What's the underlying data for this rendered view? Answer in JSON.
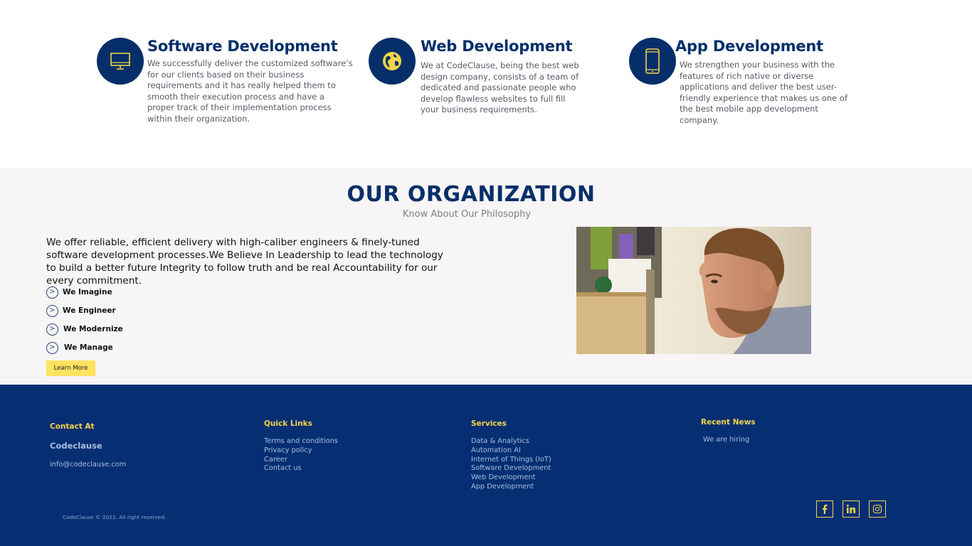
{
  "services": [
    {
      "title": "Software Development",
      "icon": "monitor-icon",
      "text": "We successfully deliver the customized software’s for our clients based on their business requirements and it has really helped them to smooth their execution process and have a proper track of their implementation process within their organization."
    },
    {
      "title": "Web Development",
      "icon": "globe-icon",
      "text": "We at CodeClause, being the best web design company, consists of a team of dedicated and passionate people who develop flawless websites to full fill your business requirements."
    },
    {
      "title": "App Development",
      "icon": "smartphone-icon",
      "text": "We strengthen your business with the features of rich native or diverse applications and deliver the best user-friendly experience that makes us one of the best mobile app development company."
    }
  ],
  "organization": {
    "title": "OUR ORGANIZATION",
    "subtitle": "Know About Our Philosophy",
    "paragraph": "We offer reliable, efficient delivery with high-caliber engineers & finely-tuned software development processes.We Believe In Leadership to lead the technology to build a better future Integrity to follow truth and be real Accountability for our every commitment.",
    "items": [
      "We Imagine",
      "We Engineer",
      "We Modernize",
      "We Manage"
    ],
    "bullet_glyph": ">",
    "button_label": "Learn More"
  },
  "footer": {
    "contact": {
      "heading": "Contact At",
      "brand": "Codeclause",
      "email": "info@codeclause.com"
    },
    "quick_links": {
      "heading": "Quick Links",
      "links": [
        "Terms and conditions",
        "Privacy policy",
        "Career",
        "Contact us"
      ]
    },
    "services": {
      "heading": "Services",
      "links": [
        "Data & Analytics",
        "Automation AI",
        "Internet of Things (IoT)",
        "Software Development",
        "Web Development",
        "App Development"
      ]
    },
    "recent_news": {
      "heading": "Recent News",
      "items": [
        "We are hiring"
      ]
    },
    "copyright": "CodeClause © 2022. All right reserved.",
    "social": [
      "facebook-icon",
      "linkedin-icon",
      "instagram-icon"
    ]
  },
  "colors": {
    "brand_navy": "#062f6a",
    "footer_bg": "#062f73",
    "accent_yellow": "#f4d44a",
    "button_yellow": "#ffe25f",
    "section_gray": "#f7f5f5"
  }
}
